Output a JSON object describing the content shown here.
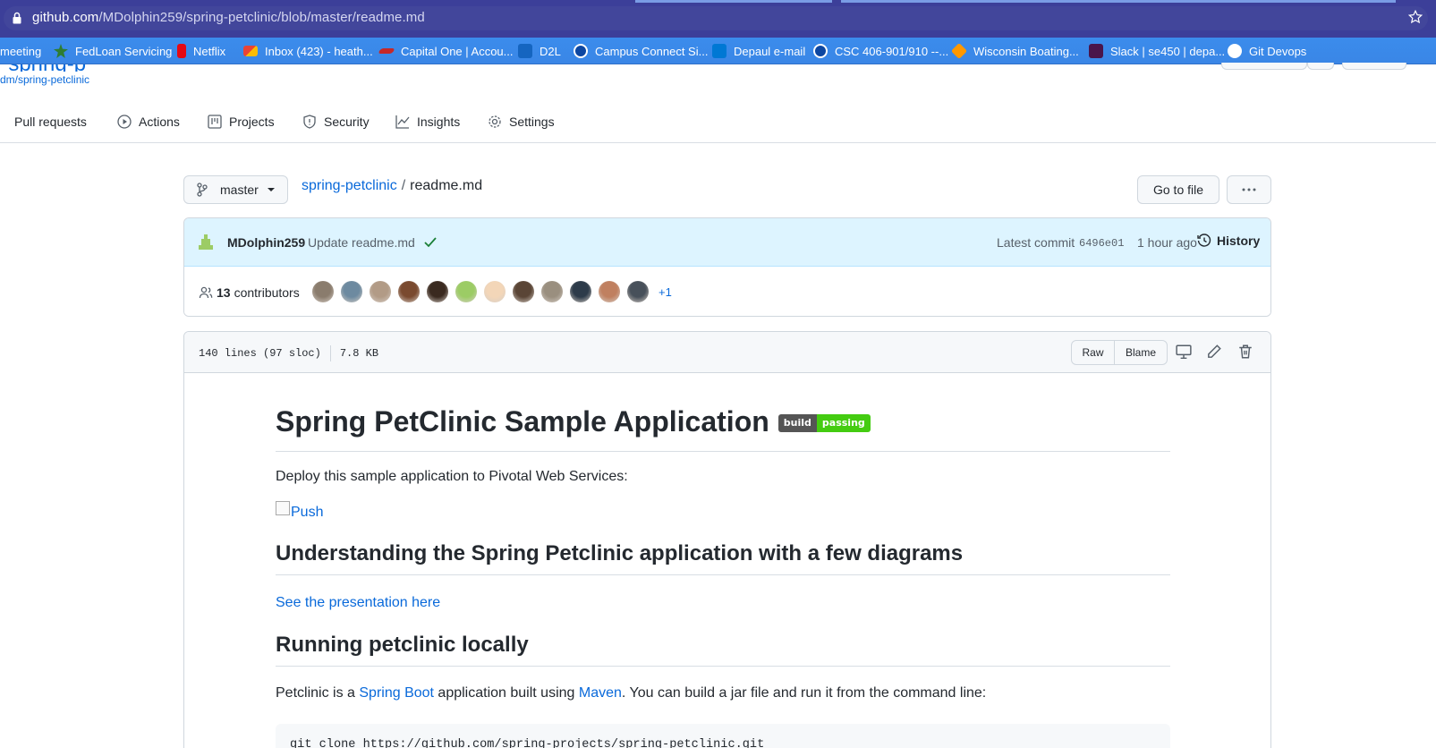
{
  "browser": {
    "url_host": "github.com",
    "url_path": "/MDolphin259/spring-petclinic/blob/master/readme.md",
    "bookmarks": [
      {
        "label": "meeting",
        "icon": "none"
      },
      {
        "label": "FedLoan Servicing",
        "icon": "fedloan-icon"
      },
      {
        "label": "Netflix",
        "icon": "netflix-icon"
      },
      {
        "label": "Inbox (423) - heath...",
        "icon": "gmail-icon"
      },
      {
        "label": "Capital One | Accou...",
        "icon": "capitalone-icon"
      },
      {
        "label": "D2L",
        "icon": "d2l-icon"
      },
      {
        "label": "Campus Connect Si...",
        "icon": "campus-connect-icon"
      },
      {
        "label": "Depaul e-mail",
        "icon": "outlook-icon"
      },
      {
        "label": "CSC 406-901/910 --...",
        "icon": "csc-icon"
      },
      {
        "label": "Wisconsin Boating...",
        "icon": "wisconsin-icon"
      },
      {
        "label": "Slack | se450 | depa...",
        "icon": "slack-icon"
      },
      {
        "label": "Git Devops",
        "icon": "github-icon"
      }
    ]
  },
  "repo": {
    "forked_from": "dm/spring-petclinic",
    "tabs": [
      {
        "label": "Pull requests",
        "icon": "pull-request-icon"
      },
      {
        "label": "Actions",
        "icon": "actions-icon"
      },
      {
        "label": "Projects",
        "icon": "projects-icon"
      },
      {
        "label": "Security",
        "icon": "shield-icon"
      },
      {
        "label": "Insights",
        "icon": "graph-icon"
      },
      {
        "label": "Settings",
        "icon": "gear-icon"
      }
    ]
  },
  "filenav": {
    "branch": "master",
    "repo_link": "spring-petclinic",
    "separator": "/",
    "filename": "readme.md",
    "go_to_file": "Go to file"
  },
  "commit": {
    "author": "MDolphin259",
    "message": "Update readme.md",
    "latest_label": "Latest commit",
    "sha": "6496e01",
    "time_ago": "1 hour ago",
    "history_label": "History",
    "contributors_count": "13",
    "contributors_label": "contributors",
    "more_contributors": "+1",
    "avatar_colors": [
      "#8a7c6d",
      "#6d8aa0",
      "#b29b86",
      "#7a4a2f",
      "#3a2a20",
      "#9ccc65",
      "#f3d6b8",
      "#5a4536",
      "#9a8f7f",
      "#2d3b4a",
      "#c08060",
      "#47505a"
    ]
  },
  "file": {
    "lines": "140 lines (97 sloc)",
    "size": "7.8 KB",
    "raw_label": "Raw",
    "blame_label": "Blame"
  },
  "readme": {
    "title": "Spring PetClinic Sample Application",
    "badge_left": "build",
    "badge_right": "passing",
    "deploy_text": "Deploy this sample application to Pivotal Web Services:",
    "push_alt": "Push",
    "h2_diagrams": "Understanding the Spring Petclinic application with a few diagrams",
    "presentation_link": "See the presentation here",
    "h2_running": "Running petclinic locally",
    "p_running_1": "Petclinic is a ",
    "p_running_link1": "Spring Boot",
    "p_running_2": " application built using ",
    "p_running_link2": "Maven",
    "p_running_3": ". You can build a jar file and run it from the command line:",
    "code_line": "git clone https://github.com/spring-projects/spring-petclinic.git"
  },
  "colors": {
    "browser_bar": "#3c3f99",
    "bookmarks_bar": "#3a86e6",
    "link": "#0969da",
    "commit_bg": "#ddf4ff",
    "badge_pass": "#44cc11"
  }
}
